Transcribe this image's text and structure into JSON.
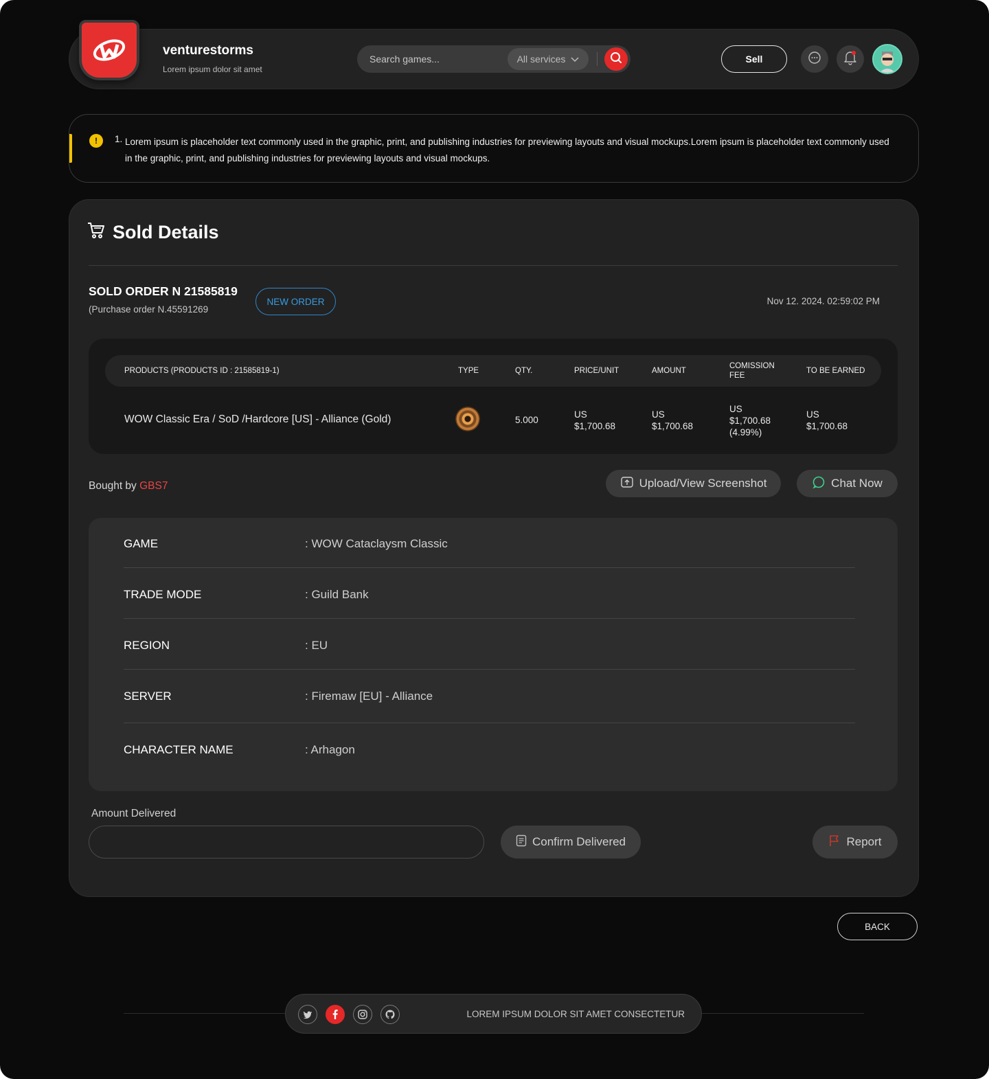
{
  "brand": {
    "name": "venturestorms",
    "tagline": "Lorem ipsum dolor sit amet"
  },
  "header": {
    "search_placeholder": "Search games...",
    "service_filter": "All services",
    "sell_label": "Sell"
  },
  "notice": {
    "number": "1.",
    "text": "Lorem ipsum is placeholder text commonly used in the graphic, print, and publishing industries for previewing layouts and visual mockups.Lorem ipsum is placeholder text commonly used in the graphic, print, and publishing industries for previewing layouts and visual mockups."
  },
  "page": {
    "title": "Sold Details",
    "order_number": "SOLD ORDER N 21585819",
    "purchase_order": "(Purchase order N.45591269",
    "status_badge": "NEW ORDER",
    "date": "Nov  12. 2024.  02:59:02  PM"
  },
  "table": {
    "headers": {
      "products": "PRODUCTS (PRODUCTS  ID : 21585819-1)",
      "type": "TYPE",
      "qty": "QTY.",
      "price": "PRICE/UNIT",
      "amount": "AMOUNT",
      "commission_1": "COMISSION",
      "commission_2": "FEE",
      "earned": "TO BE EARNED"
    },
    "row": {
      "product": "WOW Classic Era / SoD /Hardcore [US] - Alliance (Gold)",
      "type_icon": "gold-coin-icon",
      "qty": "5.000",
      "price_cur": "US",
      "price_val": "$1,700.68",
      "amount_cur": "US",
      "amount_val": "$1,700.68",
      "commission_cur": "US",
      "commission_val": "$1,700.68",
      "commission_pct": "(4.99%)",
      "earned_cur": "US",
      "earned_val": "$1,700.68"
    }
  },
  "buyer": {
    "prefix": "Bought by ",
    "name": "GBS7"
  },
  "actions": {
    "upload_screenshot": "Upload/View Screenshot",
    "chat_now": "Chat Now",
    "amount_delivered_label": "Amount Delivered",
    "amount_delivered_value": "",
    "confirm_delivered": "Confirm Delivered",
    "report": "Report",
    "back": "BACK"
  },
  "details": [
    {
      "label": "GAME",
      "value": ": WOW Cataclaysm Classic"
    },
    {
      "label": "TRADE MODE",
      "value": ": Guild Bank"
    },
    {
      "label": "REGION",
      "value": ": EU"
    },
    {
      "label": "SERVER",
      "value": ": Firemaw [EU] - Alliance"
    },
    {
      "label": "CHARACTER NAME",
      "value": ": Arhagon"
    }
  ],
  "footer": {
    "text": "LOREM IPSUM DOLOR SIT AMET CONSECTETUR",
    "social_icons": [
      "twitter-icon",
      "facebook-icon",
      "instagram-icon",
      "github-icon"
    ]
  },
  "colors": {
    "brand_red": "#e63030",
    "link_blue": "#3a9be0",
    "warning_yellow": "#f2c200",
    "buyer_red": "#e84545"
  }
}
